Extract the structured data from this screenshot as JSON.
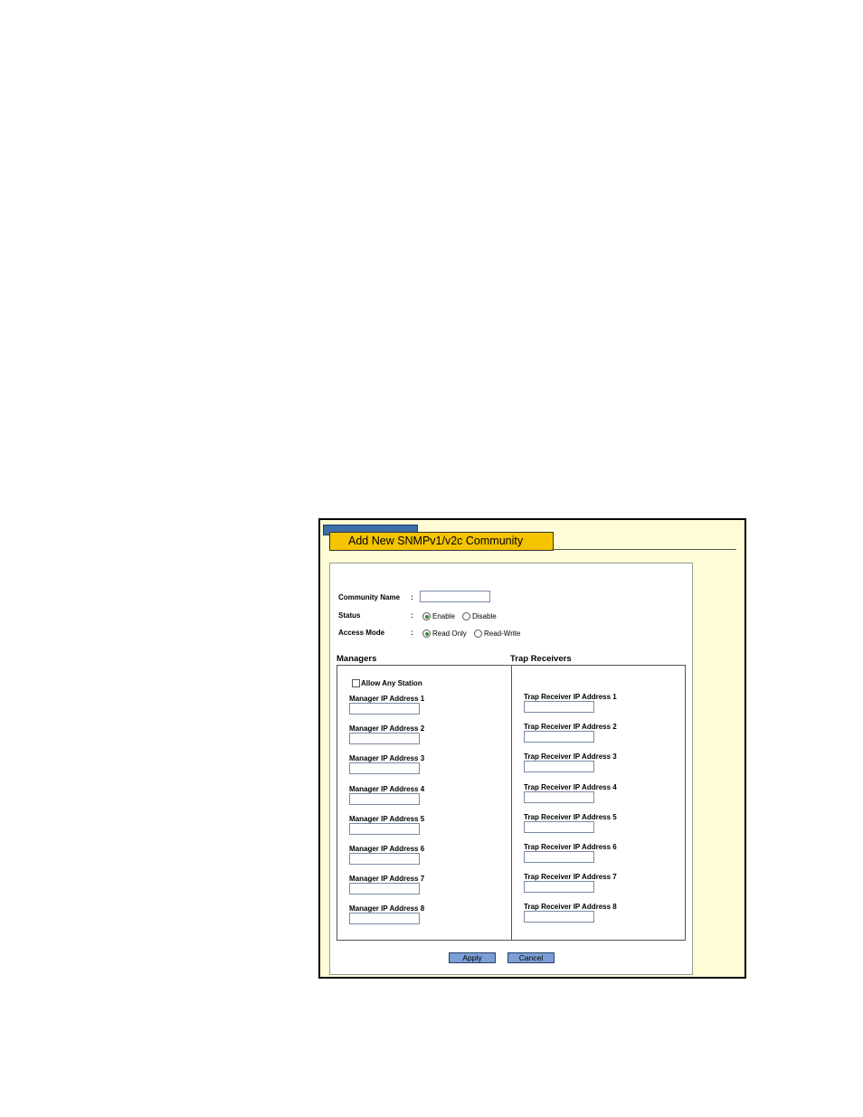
{
  "title": "Add New SNMPv1/v2c Community",
  "form": {
    "community_name_label": "Community Name",
    "status_label": "Status",
    "access_mode_label": "Access Mode",
    "colon": ":",
    "community_name_value": "",
    "status_options": [
      {
        "label": "Enable",
        "selected": true
      },
      {
        "label": "Disable",
        "selected": false
      }
    ],
    "access_options": [
      {
        "label": "Read Only",
        "selected": true
      },
      {
        "label": "Read-Write",
        "selected": false
      }
    ]
  },
  "managers": {
    "heading": "Managers",
    "allow_any_label": "Allow Any Station",
    "allow_any_checked": false,
    "fields": [
      {
        "label": "Manager IP Address 1",
        "value": ""
      },
      {
        "label": "Manager IP Address 2",
        "value": ""
      },
      {
        "label": "Manager IP Address 3",
        "value": ""
      },
      {
        "label": "Manager IP Address 4",
        "value": ""
      },
      {
        "label": "Manager IP Address 5",
        "value": ""
      },
      {
        "label": "Manager IP Address 6",
        "value": ""
      },
      {
        "label": "Manager IP Address 7",
        "value": ""
      },
      {
        "label": "Manager IP Address 8",
        "value": ""
      }
    ]
  },
  "trap_receivers": {
    "heading": "Trap Receivers",
    "fields": [
      {
        "label": "Trap Receiver IP Address 1",
        "value": ""
      },
      {
        "label": "Trap Receiver IP Address 2",
        "value": ""
      },
      {
        "label": "Trap Receiver IP Address 3",
        "value": ""
      },
      {
        "label": "Trap Receiver IP Address 4",
        "value": ""
      },
      {
        "label": "Trap Receiver IP Address 5",
        "value": ""
      },
      {
        "label": "Trap Receiver IP Address 6",
        "value": ""
      },
      {
        "label": "Trap Receiver IP Address 7",
        "value": ""
      },
      {
        "label": "Trap Receiver IP Address 8",
        "value": ""
      }
    ]
  },
  "buttons": {
    "apply": "Apply",
    "cancel": "Cancel"
  },
  "colors": {
    "tab_accent": "#f5c400",
    "tab_blue": "#3d6ea8",
    "frame_bg": "#fefdd6",
    "button": "#7b9fd3"
  }
}
